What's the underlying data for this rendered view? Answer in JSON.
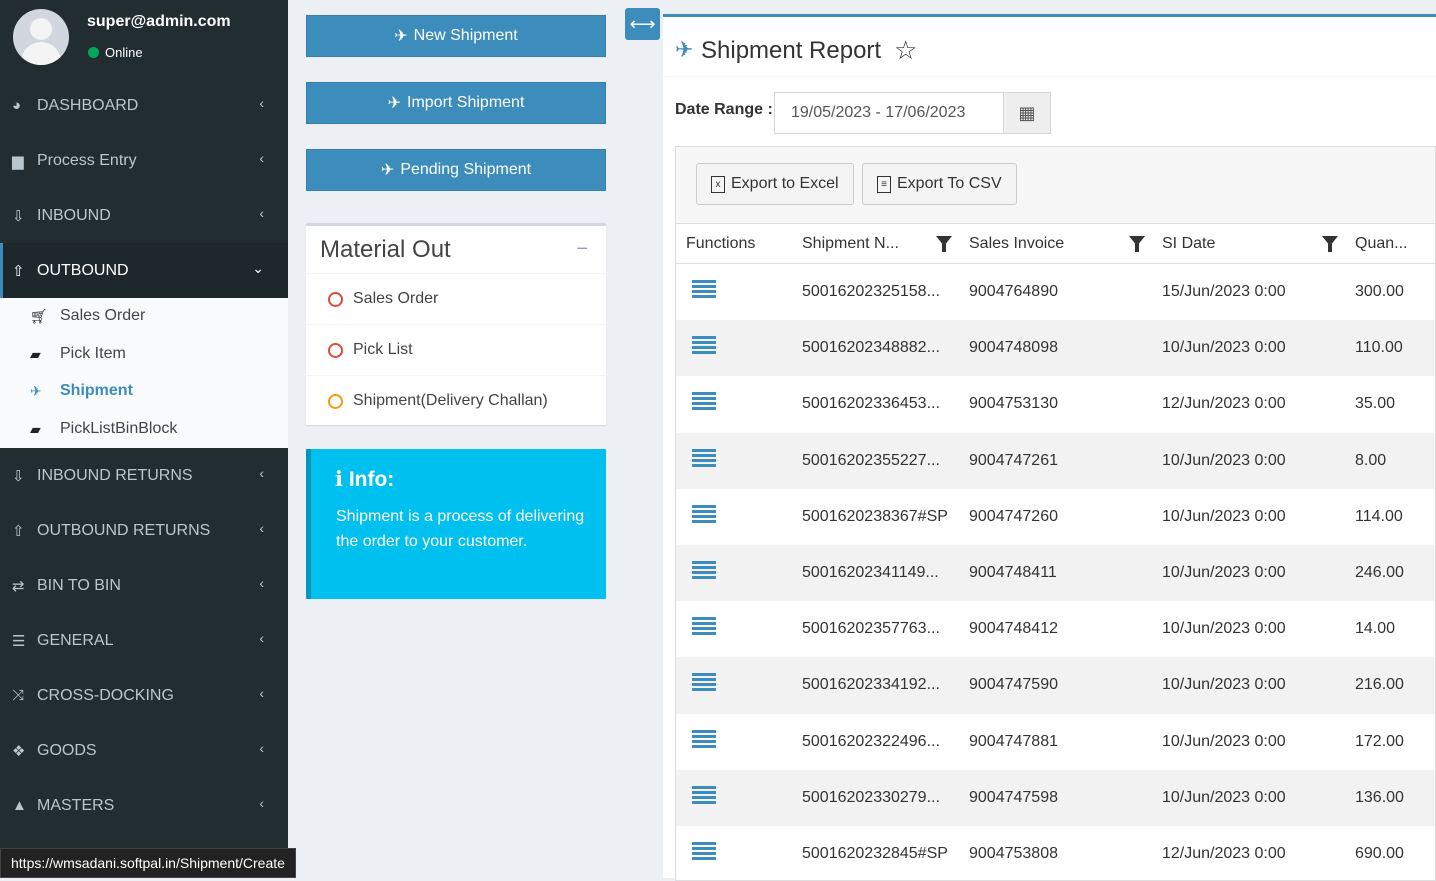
{
  "user": {
    "email": "super@admin.com",
    "status": "Online"
  },
  "sidebar": {
    "items": [
      {
        "label": "DASHBOARD",
        "icon": "pie-chart-icon"
      },
      {
        "label": "Process Entry",
        "icon": "briefcase-icon"
      },
      {
        "label": "INBOUND",
        "icon": "download-icon"
      },
      {
        "label": "OUTBOUND",
        "icon": "upload-icon"
      },
      {
        "label": "INBOUND RETURNS",
        "icon": "download-icon"
      },
      {
        "label": "OUTBOUND RETURNS",
        "icon": "upload-icon"
      },
      {
        "label": "BIN TO BIN",
        "icon": "exchange-icon"
      },
      {
        "label": "GENERAL",
        "icon": "list-icon"
      },
      {
        "label": "CROSS-DOCKING",
        "icon": "random-icon"
      },
      {
        "label": "GOODS",
        "icon": "cubes-icon"
      },
      {
        "label": "MASTERS",
        "icon": "graduation-cap-icon"
      }
    ],
    "submenu": [
      {
        "label": "Sales Order",
        "icon": "cart-icon"
      },
      {
        "label": "Pick Item",
        "icon": "truck-icon"
      },
      {
        "label": "Shipment",
        "icon": "plane-icon"
      },
      {
        "label": "PickListBinBlock",
        "icon": "truck-icon"
      }
    ]
  },
  "actions": {
    "new_shipment": "New Shipment",
    "import_shipment": "Import Shipment",
    "pending_shipment": "Pending Shipment"
  },
  "material_out": {
    "title": "Material Out",
    "links": [
      "Sales Order",
      "Pick List",
      "Shipment(Delivery Challan)"
    ]
  },
  "info": {
    "title": "Info:",
    "text": "Shipment is a process of delivering the order to your customer."
  },
  "report": {
    "title": "Shipment Report",
    "date_range_label": "Date Range :",
    "date_range_value": "19/05/2023 - 17/06/2023",
    "export_excel": "Export to Excel",
    "export_csv": "Export To CSV",
    "columns": [
      "Functions",
      "Shipment N...",
      "Sales Invoice",
      "SI Date",
      "Quan..."
    ],
    "rows": [
      {
        "shipment": "50016202325158...",
        "invoice": "9004764890",
        "si_date": "15/Jun/2023 0:00",
        "qty": "300.00"
      },
      {
        "shipment": "50016202348882...",
        "invoice": "9004748098",
        "si_date": "10/Jun/2023 0:00",
        "qty": "110.00"
      },
      {
        "shipment": "50016202336453...",
        "invoice": "9004753130",
        "si_date": "12/Jun/2023 0:00",
        "qty": "35.00"
      },
      {
        "shipment": "50016202355227...",
        "invoice": "9004747261",
        "si_date": "10/Jun/2023 0:00",
        "qty": "8.00"
      },
      {
        "shipment": "5001620238367#SP",
        "invoice": "9004747260",
        "si_date": "10/Jun/2023 0:00",
        "qty": "114.00"
      },
      {
        "shipment": "50016202341149...",
        "invoice": "9004748411",
        "si_date": "10/Jun/2023 0:00",
        "qty": "246.00"
      },
      {
        "shipment": "50016202357763...",
        "invoice": "9004748412",
        "si_date": "10/Jun/2023 0:00",
        "qty": "14.00"
      },
      {
        "shipment": "50016202334192...",
        "invoice": "9004747590",
        "si_date": "10/Jun/2023 0:00",
        "qty": "216.00"
      },
      {
        "shipment": "50016202322496...",
        "invoice": "9004747881",
        "si_date": "10/Jun/2023 0:00",
        "qty": "172.00"
      },
      {
        "shipment": "50016202330279...",
        "invoice": "9004747598",
        "si_date": "10/Jun/2023 0:00",
        "qty": "136.00"
      },
      {
        "shipment": "5001620232845#SP",
        "invoice": "9004753808",
        "si_date": "12/Jun/2023 0:00",
        "qty": "690.00"
      }
    ]
  },
  "status_url": "https://wmsadani.softpal.in/Shipment/Create",
  "colors": {
    "primary": "#3c8dbc",
    "sidebar": "#222d32",
    "info": "#00c0ef",
    "online": "#00a65a"
  }
}
